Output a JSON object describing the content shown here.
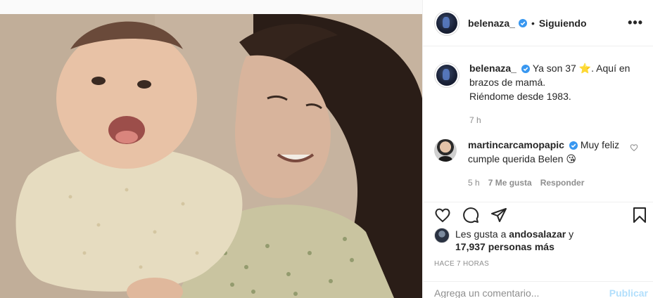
{
  "post": {
    "author": "belenaza_",
    "follow_status": "Siguiendo",
    "separator": "•",
    "more_icon": "more-options-icon",
    "more_label": "•••"
  },
  "caption": {
    "username": "belenaza_",
    "text_line1": "Ya son 37",
    "star": "⭐",
    "text_line1b": ". Aquí en",
    "text_line2": "brazos de mamá.",
    "text_line3": "Riéndome desde 1983.",
    "time": "7 h"
  },
  "comments": [
    {
      "username": "martincarcamopapic",
      "text1": "Muy feliz",
      "text2": "cumple querida Belen",
      "emoji": "😘",
      "time": "5 h",
      "likes": "7 Me gusta",
      "reply": "Responder"
    }
  ],
  "likes": {
    "prefix": "Les gusta a",
    "user": "andosalazar",
    "and": "y",
    "count": "17,937 personas más"
  },
  "timestamp": "HACE 7 HORAS",
  "add_comment": {
    "placeholder": "Agrega un comentario...",
    "post_label": "Publicar"
  },
  "colors": {
    "verified": "#3897f0",
    "post_disabled": "#b2dffc",
    "muted": "#8e8e8e"
  }
}
